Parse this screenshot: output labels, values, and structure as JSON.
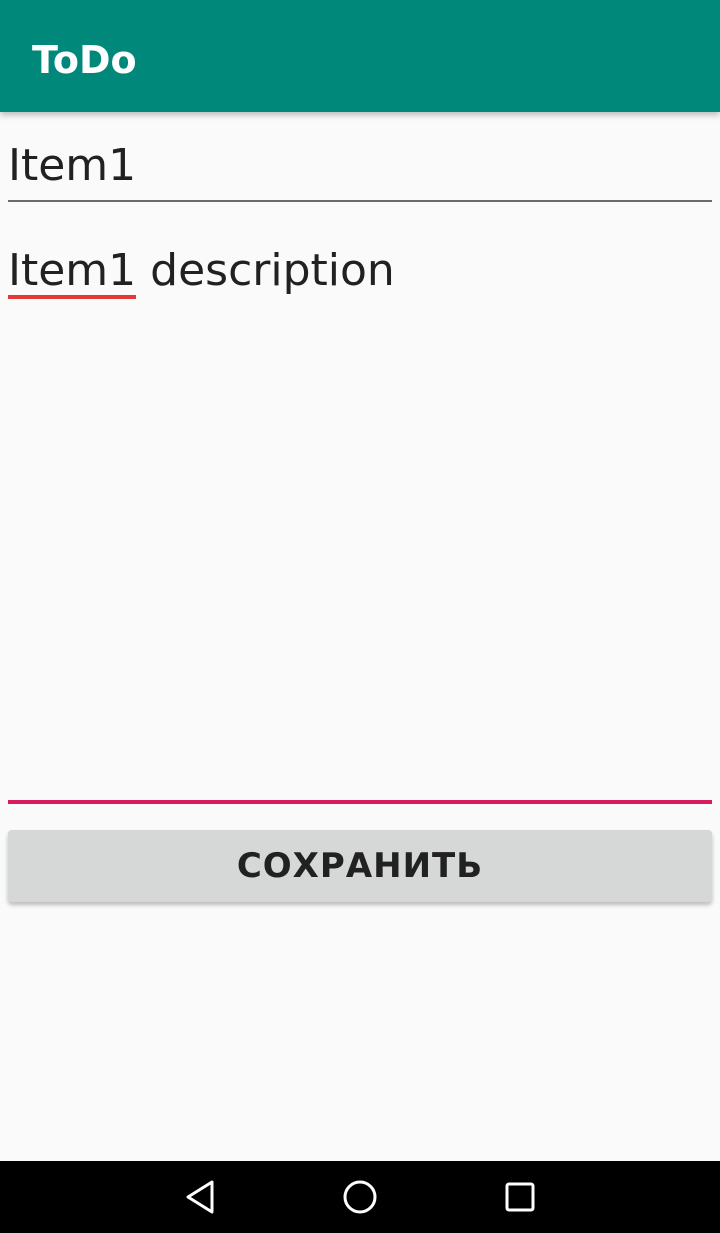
{
  "app_bar": {
    "title": "ToDo",
    "color": "#00897b"
  },
  "form": {
    "title_value": "Item1",
    "description_misspelled_word": "Item1",
    "description_rest": " description",
    "accent_color": "#d81b60",
    "spellcheck_color": "#e53935"
  },
  "save_button": {
    "label": "СОХРАНИТЬ"
  },
  "nav_bar": {
    "icons": [
      "back-icon",
      "home-icon",
      "recent-apps-icon"
    ]
  }
}
